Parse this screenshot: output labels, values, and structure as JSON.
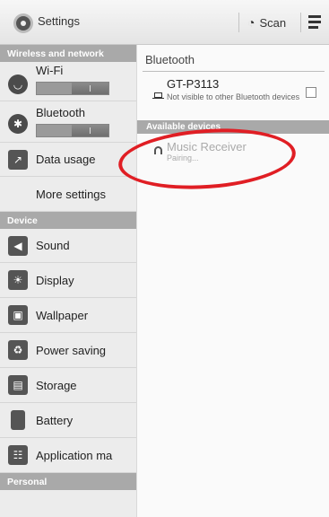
{
  "header": {
    "title": "Settings",
    "scan_label": "Scan",
    "icons": [
      "gear-icon",
      "scan-icon",
      "menu-icon"
    ]
  },
  "sidebar": {
    "sections": {
      "wireless": "Wireless and network",
      "device": "Device",
      "personal": "Personal"
    },
    "items": {
      "wifi": "Wi-Fi",
      "bluetooth": "Bluetooth",
      "data_usage": "Data usage",
      "more_settings": "More settings",
      "sound": "Sound",
      "display": "Display",
      "wallpaper": "Wallpaper",
      "power_saving": "Power saving",
      "storage": "Storage",
      "battery": "Battery",
      "application_manager": "Application ma"
    }
  },
  "bluetooth": {
    "title": "Bluetooth",
    "device": {
      "name": "GT-P3113",
      "status": "Not visible to other Bluetooth devices"
    },
    "available_header": "Available devices",
    "pairing": {
      "name": "Music Receiver",
      "status": "Pairing..."
    }
  },
  "colors": {
    "annotation": "#e01e24",
    "section_header": "#a9a9a9"
  }
}
